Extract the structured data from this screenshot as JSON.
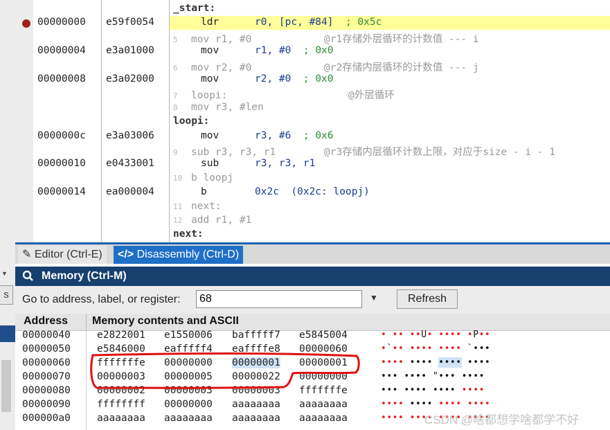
{
  "disassembly": {
    "rows": [
      {
        "addr": "",
        "hex": "",
        "line": "",
        "text": "_start:",
        "kind": "label"
      },
      {
        "addr": "00000000",
        "hex": "e59f0054",
        "line": "",
        "kind": "instr",
        "mn": "ldr",
        "ops": "r0, [pc, #84]",
        "cmt": "; 0x5c"
      },
      {
        "addr": "",
        "hex": "",
        "line": "5",
        "kind": "src",
        "text": "mov r1, #0            @r1存储外层循环的计数值 --- i"
      },
      {
        "addr": "00000004",
        "hex": "e3a01000",
        "line": "",
        "kind": "instr",
        "mn": "mov",
        "ops": "r1, #0",
        "cmt": "; 0x0"
      },
      {
        "addr": "",
        "hex": "",
        "line": "6",
        "kind": "src",
        "text": "mov r2, #0            @r2存储内层循环的计数值 --- j"
      },
      {
        "addr": "00000008",
        "hex": "e3a02000",
        "line": "",
        "kind": "instr",
        "mn": "mov",
        "ops": "r2, #0",
        "cmt": "; 0x0"
      },
      {
        "addr": "",
        "hex": "",
        "line": "7",
        "kind": "src",
        "text": "loopi:                    @外层循环"
      },
      {
        "addr": "",
        "hex": "",
        "line": "8",
        "kind": "src",
        "text": "mov r3, #len"
      },
      {
        "addr": "",
        "hex": "",
        "line": "",
        "text": "loopi:",
        "kind": "label"
      },
      {
        "addr": "0000000c",
        "hex": "e3a03006",
        "line": "",
        "kind": "instr",
        "mn": "mov",
        "ops": "r3, #6",
        "cmt": "; 0x6"
      },
      {
        "addr": "",
        "hex": "",
        "line": "9",
        "kind": "src",
        "text": "sub r3, r3, r1        @r3存储内层循环计数上限，对应于size - i - 1"
      },
      {
        "addr": "00000010",
        "hex": "e0433001",
        "line": "",
        "kind": "instr",
        "mn": "sub",
        "ops": "r3, r3, r1",
        "cmt": ""
      },
      {
        "addr": "",
        "hex": "",
        "line": "10",
        "kind": "src",
        "text": "b loopj"
      },
      {
        "addr": "00000014",
        "hex": "ea000004",
        "line": "",
        "kind": "instr",
        "mn": "b",
        "ops": "0x2c",
        "cmt": "(0x2c: loopj)"
      },
      {
        "addr": "",
        "hex": "",
        "line": "11",
        "kind": "src",
        "text": "next:"
      },
      {
        "addr": "",
        "hex": "",
        "line": "12",
        "kind": "src",
        "text": "add r1, #1"
      },
      {
        "addr": "",
        "hex": "",
        "line": "",
        "text": "next:",
        "kind": "label"
      }
    ]
  },
  "tabs": {
    "editor": "Editor (Ctrl-E)",
    "disassembly": "Disassembly (Ctrl-D)"
  },
  "sidebar": {
    "tab_letter": "s"
  },
  "memory": {
    "title": "Memory (Ctrl-M)",
    "goto_label": "Go to address, label, or register:",
    "goto_value": "68",
    "refresh_label": "Refresh",
    "col_address": "Address",
    "col_contents": "Memory contents and ASCII",
    "rows": [
      {
        "addr": "00000040",
        "w": [
          "e2822001",
          "e1550006",
          "bafffff7",
          "e5845004"
        ],
        "ascii": [
          [
            "r",
            "•"
          ],
          [
            "k",
            " "
          ],
          [
            "r",
            "••"
          ],
          [
            "k",
            " "
          ],
          [
            "r",
            "••"
          ],
          [
            "k",
            "U"
          ],
          [
            "r",
            "•"
          ],
          [
            "k",
            " "
          ],
          [
            "r",
            "••••"
          ],
          [
            "k",
            " "
          ],
          [
            "r",
            "•"
          ],
          [
            "k",
            "P"
          ],
          [
            "r",
            "••"
          ]
        ]
      },
      {
        "addr": "00000050",
        "w": [
          "e5846000",
          "eafffff4",
          "eaffffe8",
          "00000060"
        ],
        "ascii": [
          [
            "r",
            "•"
          ],
          [
            "k",
            "`"
          ],
          [
            "r",
            "••"
          ],
          [
            "k",
            " "
          ],
          [
            "r",
            "••••"
          ],
          [
            "k",
            " "
          ],
          [
            "r",
            "••••"
          ],
          [
            "k",
            " "
          ],
          [
            "k",
            "`•••"
          ]
        ]
      },
      {
        "addr": "00000060",
        "w": [
          "fffffffe",
          "00000000",
          "00000001",
          "00000001"
        ],
        "ascii": [
          [
            "r",
            "••••"
          ],
          [
            "k",
            " "
          ],
          [
            "k",
            "••••"
          ],
          [
            "k",
            " "
          ],
          [
            "k",
            "••••"
          ],
          [
            "k",
            " "
          ],
          [
            "k",
            "••••"
          ]
        ]
      },
      {
        "addr": "00000070",
        "w": [
          "00000003",
          "00000005",
          "00000022",
          "00000000"
        ],
        "ascii": [
          [
            "k",
            "•••"
          ],
          [
            "k",
            " "
          ],
          [
            "k",
            "••••"
          ],
          [
            "k",
            " "
          ],
          [
            "k",
            "\"•••"
          ],
          [
            "k",
            " "
          ],
          [
            "k",
            "••••"
          ]
        ]
      },
      {
        "addr": "00000080",
        "w": [
          "00000002",
          "00000003",
          "00000003",
          "fffffffe"
        ],
        "ascii": [
          [
            "k",
            "•••"
          ],
          [
            "k",
            " "
          ],
          [
            "k",
            "••••"
          ],
          [
            "k",
            " "
          ],
          [
            "k",
            "••••"
          ],
          [
            "k",
            " "
          ],
          [
            "r",
            "••••"
          ]
        ]
      },
      {
        "addr": "00000090",
        "w": [
          "ffffffff",
          "00000000",
          "aaaaaaaa",
          "aaaaaaaa"
        ],
        "ascii": [
          [
            "r",
            "••••"
          ],
          [
            "k",
            " "
          ],
          [
            "k",
            "••••"
          ],
          [
            "k",
            " "
          ],
          [
            "r",
            "••••"
          ],
          [
            "k",
            " "
          ],
          [
            "r",
            "••••"
          ]
        ]
      },
      {
        "addr": "000000a0",
        "w": [
          "aaaaaaaa",
          "aaaaaaaa",
          "aaaaaaaa",
          "aaaaaaaa"
        ],
        "ascii": [
          [
            "r",
            "••••"
          ],
          [
            "k",
            " "
          ],
          [
            "r",
            "••••"
          ],
          [
            "k",
            " "
          ],
          [
            "r",
            "••••"
          ],
          [
            "k",
            " "
          ],
          [
            "r",
            "••••"
          ]
        ]
      }
    ],
    "selected_word": {
      "row": 2,
      "col": 2
    }
  },
  "watermark": "CSDN @啥都想学啥都学不好",
  "colors": {
    "highlight_row": "#ffff99",
    "header": "#17406e",
    "annotation": "#e01010",
    "tab_active": "#1f6fc7"
  }
}
